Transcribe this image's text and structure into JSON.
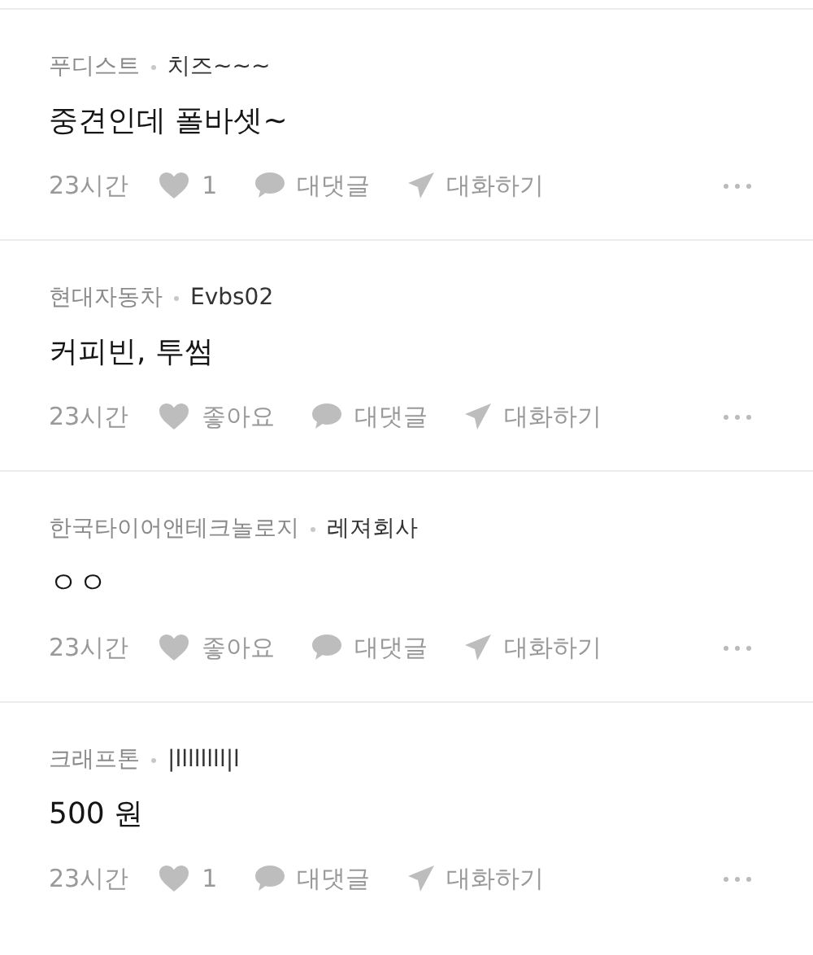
{
  "posts": [
    {
      "company": "푸디스트",
      "nickname": "치즈~~~",
      "body": "중견인데 폴바셋~",
      "time": "23시간",
      "like_label": "1",
      "reply_label": "대댓글",
      "chat_label": "대화하기"
    },
    {
      "company": "현대자동차",
      "nickname": "Evbs02",
      "body": "커피빈, 투썸",
      "time": "23시간",
      "like_label": "좋아요",
      "reply_label": "대댓글",
      "chat_label": "대화하기"
    },
    {
      "company": "한국타이어앤테크놀로지",
      "nickname": "레져회사",
      "body": "ㅇㅇ",
      "time": "23시간",
      "like_label": "좋아요",
      "reply_label": "대댓글",
      "chat_label": "대화하기"
    },
    {
      "company": "크래프톤",
      "nickname": "|llllllll|l",
      "body": "500 원",
      "time": "23시간",
      "like_label": "1",
      "reply_label": "대댓글",
      "chat_label": "대화하기"
    }
  ]
}
